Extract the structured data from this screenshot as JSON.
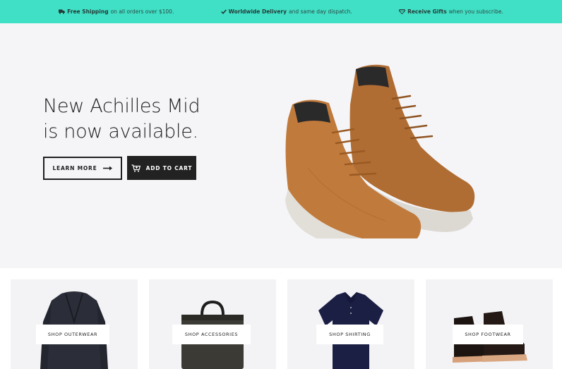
{
  "topbar": {
    "shipping": {
      "icon": "truck-icon",
      "bold": "Free Shipping",
      "rest": "on all orders over $100."
    },
    "delivery": {
      "icon": "check-icon",
      "bold": "Worldwide Delivery",
      "rest": "and same day dispatch."
    },
    "gifts": {
      "icon": "diamond-icon",
      "bold": "Receive Gifts",
      "rest": "when you subscribe."
    },
    "background": "#3fe0c5"
  },
  "hero": {
    "title_line1": "New Achilles Mid",
    "title_line2": "is now available.",
    "learn_more_label": "LEARN MORE",
    "add_to_cart_label": "ADD TO CART",
    "arrow_icon": "arrow-right-icon",
    "cart_icon": "cart-plus-icon",
    "background": "#f5f5f8",
    "product_color": "#c07a3c"
  },
  "categories": [
    {
      "label": "SHOP OUTERWEAR",
      "icon": "jacket-image"
    },
    {
      "label": "SHOP ACCESSORIES",
      "icon": "bag-image"
    },
    {
      "label": "SHOP SHIRTING",
      "icon": "shirt-image"
    },
    {
      "label": "SHOP FOOTWEAR",
      "icon": "boots-image"
    }
  ]
}
